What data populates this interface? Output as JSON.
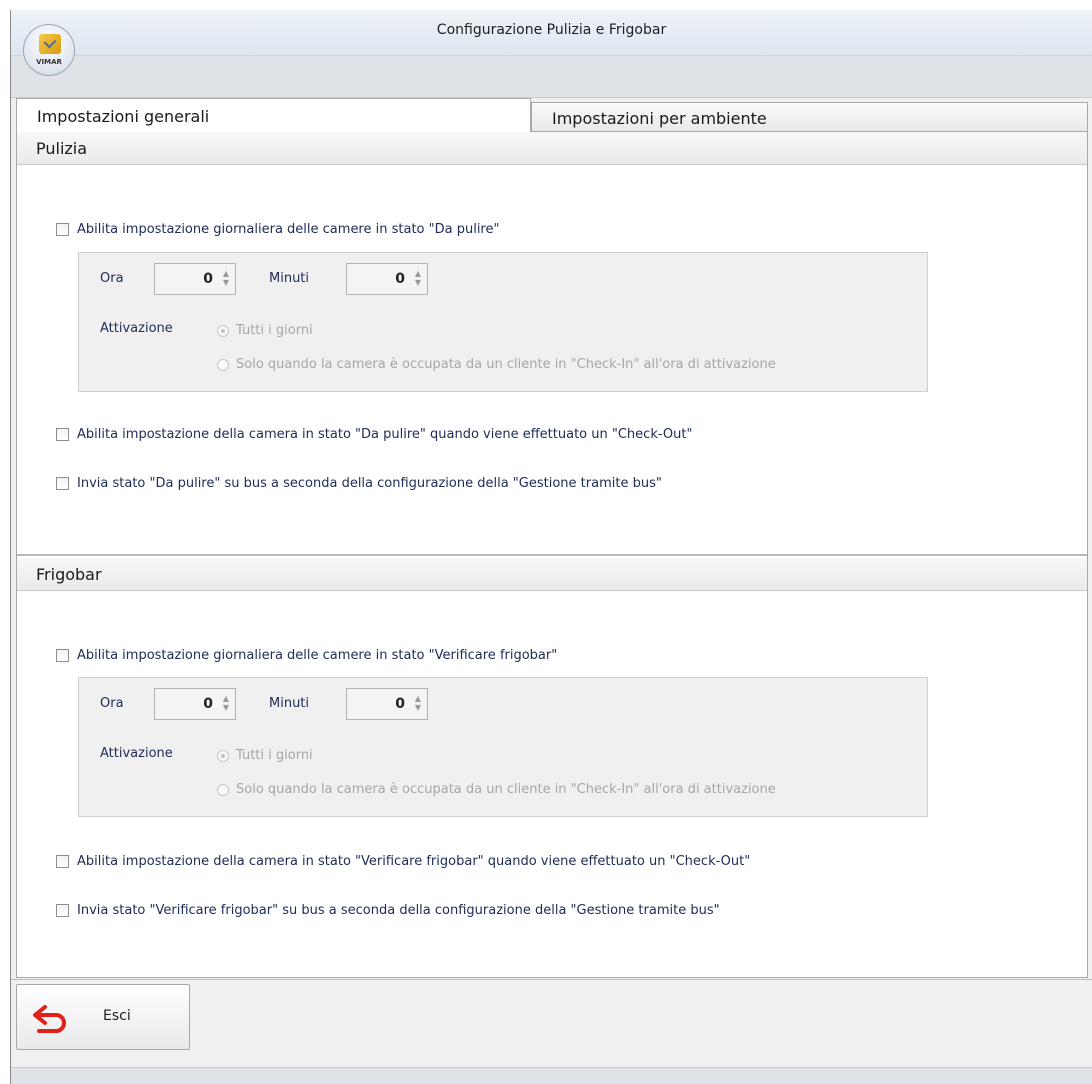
{
  "window": {
    "title": "Configurazione Pulizia e Frigobar"
  },
  "logo": {
    "text": "VIMAR"
  },
  "tabs": [
    {
      "label": "Impostazioni generali",
      "active": true
    },
    {
      "label": "Impostazioni per ambiente",
      "active": false
    }
  ],
  "pulizia": {
    "title": "Pulizia",
    "daily_checkbox": {
      "label": "Abilita impostazione giornaliera delle camere in stato \"Da pulire\"",
      "checked": false
    },
    "ora_label": "Ora",
    "ora_value": "0",
    "minuti_label": "Minuti",
    "minuti_value": "0",
    "attivazione_label": "Attivazione",
    "radio_all": "Tutti i giorni",
    "radio_checkin": "Solo quando la camera è occupata da un cliente in \"Check-In\" all'ora di attivazione",
    "checkout_checkbox": {
      "label": "Abilita impostazione della camera in stato \"Da pulire\" quando viene effettuato un \"Check-Out\"",
      "checked": false
    },
    "bus_checkbox": {
      "label": "Invia stato \"Da pulire\" su bus a seconda della configurazione della \"Gestione tramite bus\"",
      "checked": false
    }
  },
  "frigobar": {
    "title": "Frigobar",
    "daily_checkbox": {
      "label": "Abilita impostazione giornaliera delle camere in stato \"Verificare frigobar\"",
      "checked": false
    },
    "ora_label": "Ora",
    "ora_value": "0",
    "minuti_label": "Minuti",
    "minuti_value": "0",
    "attivazione_label": "Attivazione",
    "radio_all": "Tutti i giorni",
    "radio_checkin": "Solo quando la camera è occupata da un cliente in \"Check-In\" all'ora di attivazione",
    "checkout_checkbox": {
      "label": "Abilita impostazione della camera in stato \"Verificare frigobar\" quando viene effettuato un \"Check-Out\"",
      "checked": false
    },
    "bus_checkbox": {
      "label": "Invia stato \"Verificare frigobar\" su bus a seconda della configurazione della \"Gestione tramite bus\"",
      "checked": false
    }
  },
  "footer": {
    "exit_label": "Esci",
    "exit_icon": "return-arrow-icon"
  },
  "colors": {
    "accent_red": "#e0201b",
    "label_text": "#1e2b55",
    "disabled_text": "#a6a6a6"
  }
}
